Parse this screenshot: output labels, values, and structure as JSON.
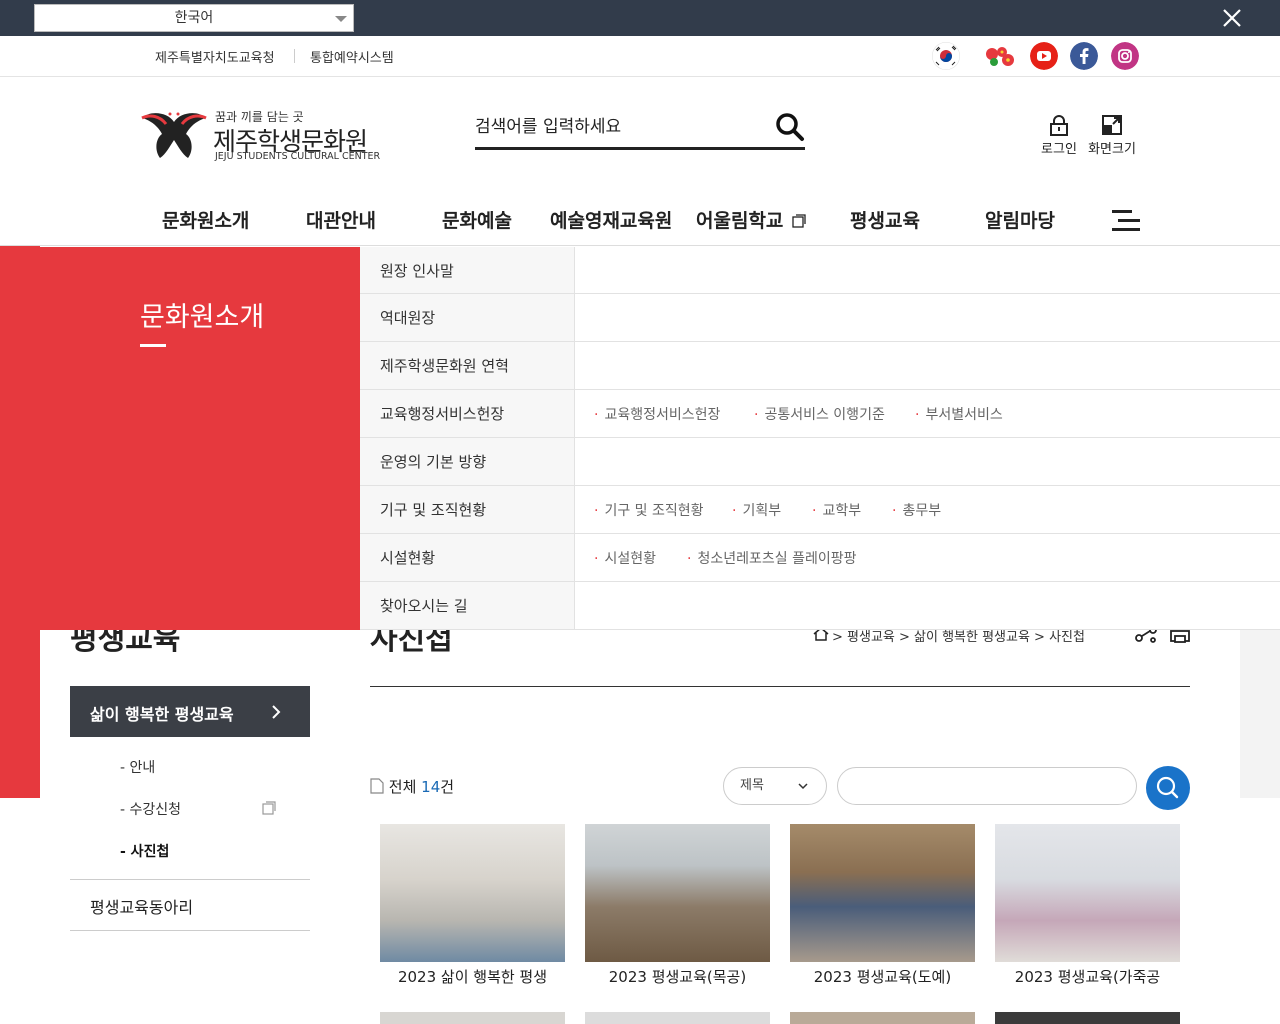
{
  "lang_bar": {
    "selected": "한국어"
  },
  "util": {
    "link1": "제주특별자치도교육청",
    "link2": "통합예약시스템"
  },
  "header": {
    "slogan": "꿈과 끼를 담는 곳",
    "name": "제주학생문화원",
    "name_en": "JEJU STUDENTS CULTURAL CENTER",
    "search_placeholder": "검색어를 입력하세요",
    "login": "로그인",
    "zoom": "화면크기"
  },
  "gnb": [
    "문화원소개",
    "대관안내",
    "문화예술",
    "예술영재교육원",
    "어울림학교",
    "평생교육",
    "알림마당"
  ],
  "mega": {
    "title": "문화원소개",
    "rows": [
      {
        "label": "원장 인사말",
        "subs": []
      },
      {
        "label": "역대원장",
        "subs": []
      },
      {
        "label": "제주학생문화원 연혁",
        "subs": []
      },
      {
        "label": "교육행정서비스헌장",
        "subs": [
          "교육행정서비스헌장",
          "공통서비스 이행기준",
          "부서별서비스"
        ]
      },
      {
        "label": "운영의 기본 방향",
        "subs": []
      },
      {
        "label": "기구 및 조직현황",
        "subs": [
          "기구 및 조직현황",
          "기획부",
          "교학부",
          "총무부"
        ]
      },
      {
        "label": "시설현황",
        "subs": [
          "시설현황",
          "청소년레포츠실 플레이팡팡"
        ]
      },
      {
        "label": "찾아오시는 길",
        "subs": []
      }
    ]
  },
  "page": {
    "lnb_title": "평생교육",
    "content_title": "사진첩",
    "breadcrumb": "> 평생교육 > 삶이 행복한 평생교육 > 사진첩",
    "lnb_active": "삶이 행복한 평생교육",
    "lnb_subs": [
      "- 안내",
      "- 수강신청",
      "- 사진첩"
    ],
    "lnb_item2": "평생교육동아리",
    "count_label": "전체",
    "count_num": "14",
    "count_unit": "건",
    "filter_selected": "제목",
    "gallery": [
      "2023 삶이 행복한 평생",
      "2023 평생교육(목공)",
      "2023 평생교육(도예)",
      "2023 평생교육(가죽공"
    ]
  },
  "colors": {
    "accent_red": "#e6393e",
    "dark_bar": "#323c4b",
    "search_blue": "#1a73c9"
  }
}
